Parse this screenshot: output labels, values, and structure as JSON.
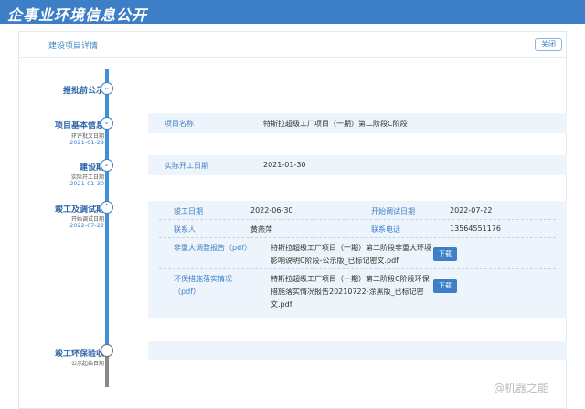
{
  "header": {
    "title": "企事业环境信息公开"
  },
  "card": {
    "title": "建设项目详情",
    "close_label": "关闭"
  },
  "steps": [
    {
      "label": "报批前公示",
      "sub": "",
      "date": ""
    },
    {
      "label": "项目基本信息",
      "sub": "环评批文日期",
      "date": "2021-01-29"
    },
    {
      "label": "建设期",
      "sub": "实际开工日期",
      "date": "2021-01-30"
    },
    {
      "label": "竣工及调试期",
      "sub": "开始调试日期",
      "date": "2022-07-22"
    },
    {
      "label": "竣工环保验收",
      "sub": "公示起始日期",
      "date": ""
    }
  ],
  "basic_info": {
    "project_name_label": "项目名称",
    "project_name_value": "特斯拉超级工厂项目（一期）第二阶段C阶段"
  },
  "construction": {
    "start_date_label": "实际开工日期",
    "start_date_value": "2021-01-30"
  },
  "completion": {
    "completion_date_label": "竣工日期",
    "completion_date_value": "2022-06-30",
    "debug_start_label": "开始调试日期",
    "debug_start_value": "2022-07-22",
    "contact_label": "联系人",
    "contact_value": "黄燕萍",
    "phone_label": "联系电话",
    "phone_value": "13564551176",
    "report1_label": "非重大调整报告（pdf）",
    "report1_line1": "特斯拉超级工厂项目（一期）第二阶段非重大环境",
    "report1_line2": "影响说明C阶段-公示版_已标记密文.pdf",
    "report2_label_line1": "环保措施落实情况",
    "report2_label_line2": "（pdf）",
    "report2_line1": "特斯拉超级工厂项目（一期）第二阶段C阶段环保",
    "report2_line2": "措施落实情况报告20210722-涂黑版_已标记密",
    "report2_line3": "文.pdf",
    "download_label": "下载"
  },
  "watermark": "@机器之能"
}
